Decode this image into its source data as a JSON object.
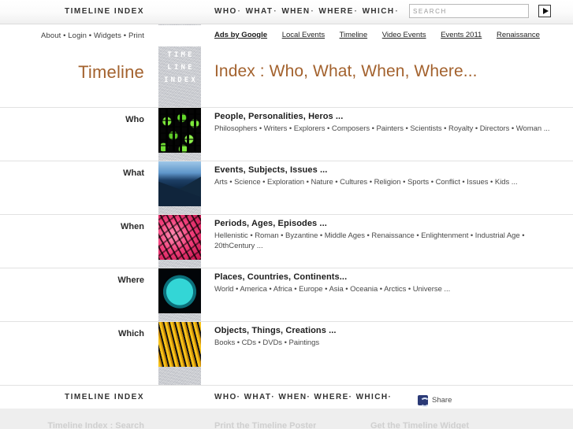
{
  "brand": {
    "name": "TIMELINE INDEX",
    "strip": [
      "TIME",
      "LINE",
      "INDEX"
    ],
    "hero_left": "Timeline",
    "hero_title": "Index : Who, What, When, Where...",
    "accent_color": "#a3622e"
  },
  "topnav": {
    "items": [
      "WHO",
      "WHAT",
      "WHEN",
      "WHERE",
      "WHICH"
    ],
    "separator": "·"
  },
  "search": {
    "value": "",
    "placeholder": "SEARCH",
    "submit_icon": "play-triangle-icon"
  },
  "meta": {
    "links": [
      "About",
      "Login",
      "Widgets",
      "Print"
    ],
    "separator": "•"
  },
  "ads": {
    "label": "Ads by Google",
    "links": [
      "Local Events",
      "Timeline",
      "Video Events",
      "Events 2011",
      "Renaissance"
    ]
  },
  "rows": [
    {
      "label": "Who",
      "thumb": "crowd-of-people-thumbnail",
      "title": "People, Personalities, Heros ...",
      "subtitle": "Philosophers • Writers • Explorers • Composers • Painters • Scientists • Royalty • Directors • Woman ..."
    },
    {
      "label": "What",
      "thumb": "mountain-landscape-thumbnail",
      "title": "Events, Subjects, Issues ...",
      "subtitle": "Arts • Science • Exploration • Nature • Cultures • Religion • Sports • Conflict • Issues • Kids ..."
    },
    {
      "label": "When",
      "thumb": "numbers-pink-thumbnail",
      "title": "Periods, Ages, Episodes ...",
      "subtitle": "Hellenistic • Roman • Byzantine • Middle Ages • Renaissance • Enlightenment • Industrial Age • 20thCentury ..."
    },
    {
      "label": "Where",
      "thumb": "globe-world-thumbnail",
      "title": "Places, Countries, Continents...",
      "subtitle": "World • America • Africa • Europe • Asia • Oceania • Arctics • Universe ..."
    },
    {
      "label": "Which",
      "thumb": "books-shelf-thumbnail",
      "title": "Objects, Things, Creations ...",
      "subtitle": "Books • CDs • DVDs • Paintings"
    }
  ],
  "footer": {
    "brand": "TIMELINE INDEX",
    "nav": [
      "WHO",
      "WHAT",
      "WHEN",
      "WHERE",
      "WHICH"
    ],
    "separator": "·",
    "share_label": "Share",
    "share_icon": "share-icon"
  },
  "bottom": {
    "col1": "Timeline Index : Search",
    "col2": "Print the Timeline Poster",
    "col3": "Get the Timeline Widget"
  }
}
